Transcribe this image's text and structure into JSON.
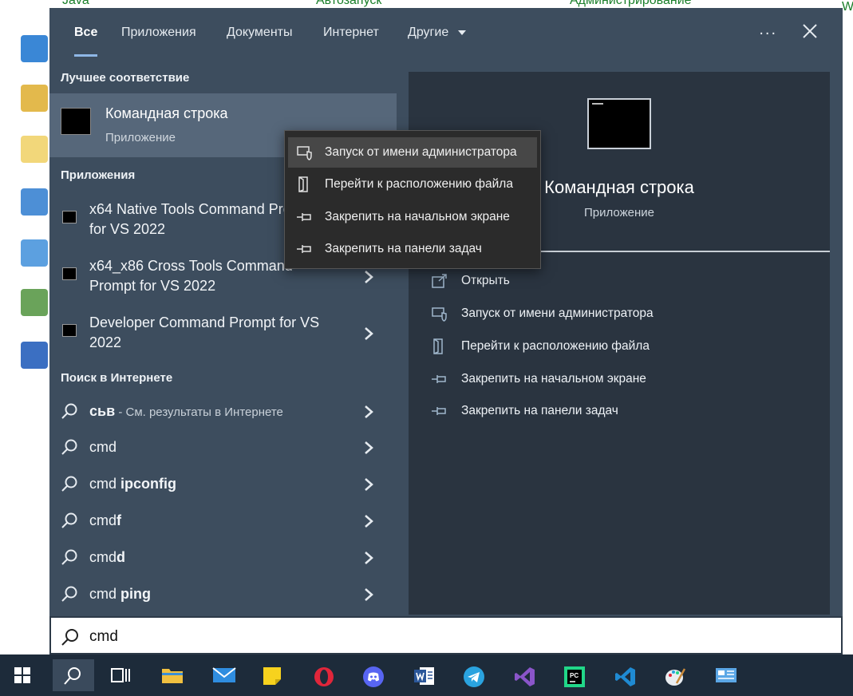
{
  "desktop": {
    "top_labels": [
      "Java",
      "Автозапуск",
      "Администрирование"
    ],
    "right_edge_label": "Win"
  },
  "tabs": [
    "Все",
    "Приложения",
    "Документы",
    "Интернет",
    "Другие"
  ],
  "tabs_more_label": "...",
  "best_match": {
    "section": "Лучшее соответствие",
    "title": "Командная строка",
    "subtitle": "Приложение"
  },
  "apps": {
    "section": "Приложения",
    "items": [
      {
        "line1": "x64 Native Tools Command Prompt",
        "line2": "for VS 2022"
      },
      {
        "line1": "x64_x86 Cross Tools Command",
        "line2": "Prompt for VS 2022"
      },
      {
        "line1": "Developer Command Prompt for VS",
        "line2": "2022"
      }
    ]
  },
  "web": {
    "section": "Поиск в Интернете",
    "items": [
      {
        "prefix": "",
        "bold": "сьв",
        "hint": " - См. результаты в Интернете"
      },
      {
        "prefix": "cmd",
        "bold": "",
        "hint": ""
      },
      {
        "prefix": "cmd ",
        "bold": "ipconfig",
        "hint": ""
      },
      {
        "prefix": "cmd",
        "bold": "f",
        "hint": ""
      },
      {
        "prefix": "cmd",
        "bold": "d",
        "hint": ""
      },
      {
        "prefix": "cmd ",
        "bold": "ping",
        "hint": ""
      }
    ]
  },
  "preview": {
    "title": "Командная строка",
    "subtitle": "Приложение",
    "actions": [
      {
        "label": "Открыть",
        "icon": "open-icon"
      },
      {
        "label": "Запуск от имени администратора",
        "icon": "shield-icon"
      },
      {
        "label": "Перейти к расположению файла",
        "icon": "file-location-icon"
      },
      {
        "label": "Закрепить на начальном экране",
        "icon": "pin-icon"
      },
      {
        "label": "Закрепить на панели задач",
        "icon": "pin-icon"
      }
    ]
  },
  "context_menu": {
    "items": [
      {
        "label": "Запуск от имени администратора",
        "icon": "shield-icon"
      },
      {
        "label": "Перейти к расположению файла",
        "icon": "file-location-icon"
      },
      {
        "label": "Закрепить на начальном экране",
        "icon": "pin-icon"
      },
      {
        "label": "Закрепить на панели задач",
        "icon": "pin-icon"
      }
    ]
  },
  "search": {
    "value": "cmd"
  },
  "taskbar": {
    "items": [
      "windows-start-icon",
      "search-icon",
      "task-view-icon",
      "file-explorer-icon",
      "mail-icon",
      "sticky-notes-icon",
      "opera-icon",
      "discord-icon",
      "word-icon",
      "telegram-icon",
      "visual-studio-icon",
      "pycharm-icon",
      "vscode-icon",
      "paint-icon",
      "control-panel-icon"
    ]
  },
  "colors": {
    "panel_bg": "#3d4d5e",
    "preview_bg": "#2a3440",
    "accent": "#8fb7e6",
    "taskbar_bg": "#1d2b3a"
  }
}
